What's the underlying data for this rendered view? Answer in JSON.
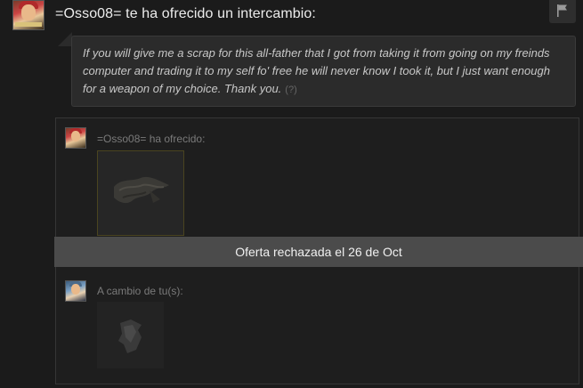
{
  "header": {
    "title": "=Osso08= te ha ofrecido un intercambio:"
  },
  "message": {
    "text": "If you will give me a scrap for this all-father that I got from taking it from going on my freinds computer and trading it to my self fo' free he will never know I took it, but I just want enough for a weapon of my choice. Thank you.",
    "help_link": "(?)"
  },
  "trade": {
    "offer_label": "=Osso08= ha ofrecido:",
    "return_label": "A cambio de tu(s):",
    "status": "Oferta rechazada el 26 de Oct"
  },
  "icons": {
    "flag": "flag-icon",
    "offered_item": "all-father-beard-item-icon",
    "return_item": "scrap-metal-item-icon"
  },
  "colors": {
    "background": "#1b1b1b",
    "bubble": "#2b2b2b",
    "status_bar": "#4b4b4b",
    "item_border_unique": "#4a4420"
  }
}
